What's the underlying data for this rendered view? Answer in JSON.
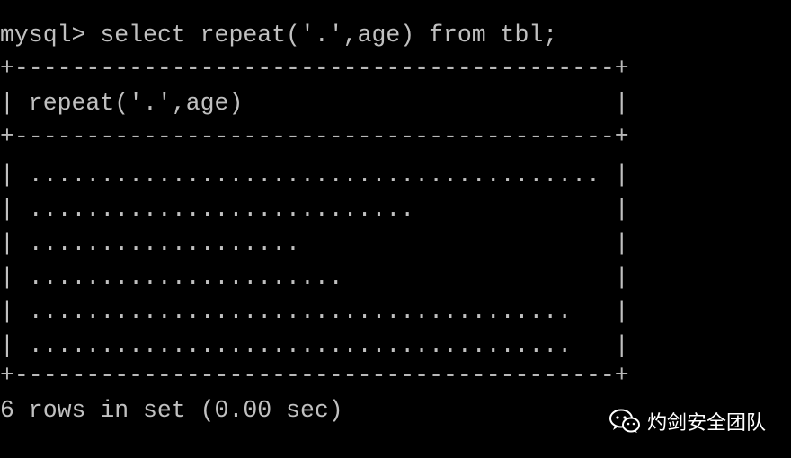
{
  "terminal": {
    "prompt": "mysql> ",
    "command": "select repeat('.',age) from tbl;",
    "border": "+------------------------------------------+",
    "header_row": "| repeat('.',age)                          |",
    "rows": [
      "| ........................................ |",
      "| ...........................              |",
      "| ...................                      |",
      "| ......................                   |",
      "| ......................................   |",
      "| ......................................   |"
    ],
    "footer": "6 rows in set (0.00 sec)"
  },
  "watermark": {
    "icon": "wechat-icon",
    "text": "灼剑安全团队"
  }
}
